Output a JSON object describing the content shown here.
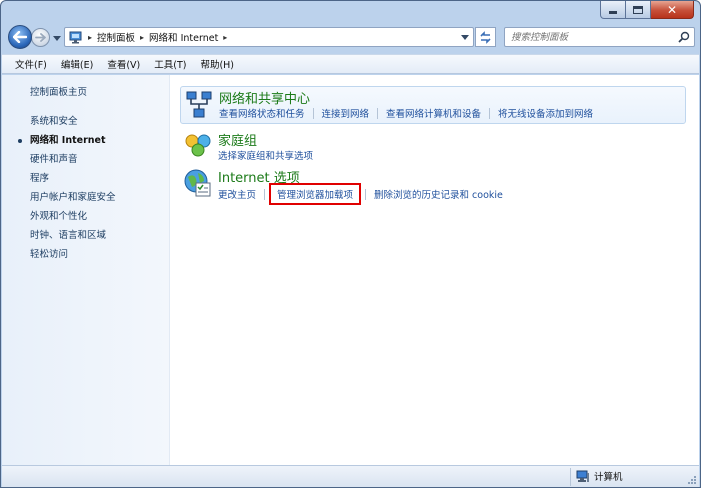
{
  "window": {
    "close_glyph": "✕"
  },
  "address": {
    "crumbs": [
      "控制面板",
      "网络和 Internet"
    ],
    "separator": "▸"
  },
  "search": {
    "placeholder": "搜索控制面板"
  },
  "menu": {
    "items": [
      "文件(F)",
      "编辑(E)",
      "查看(V)",
      "工具(T)",
      "帮助(H)"
    ]
  },
  "sidebar": {
    "home": "控制面板主页",
    "items": [
      "系统和安全",
      "网络和 Internet",
      "硬件和声音",
      "程序",
      "用户帐户和家庭安全",
      "外观和个性化",
      "时钟、语言和区域",
      "轻松访问"
    ],
    "current_index": 1
  },
  "categories": [
    {
      "title": "网络和共享中心",
      "icon": "network-sharing-icon",
      "links": [
        "查看网络状态和任务",
        "连接到网络",
        "查看网络计算机和设备",
        "将无线设备添加到网络"
      ]
    },
    {
      "title": "家庭组",
      "icon": "homegroup-icon",
      "links": [
        "选择家庭组和共享选项"
      ]
    },
    {
      "title": "Internet 选项",
      "icon": "internet-options-icon",
      "links": [
        "更改主页",
        "管理浏览器加载项",
        "删除浏览的历史记录和 cookie"
      ],
      "highlighted_link_index": 1
    }
  ],
  "status": {
    "location": "计算机"
  },
  "colors": {
    "link": "#1e4f9c",
    "category_title": "#1b7a18",
    "highlight_box": "#e00000",
    "frame": "#bcd2ec"
  }
}
